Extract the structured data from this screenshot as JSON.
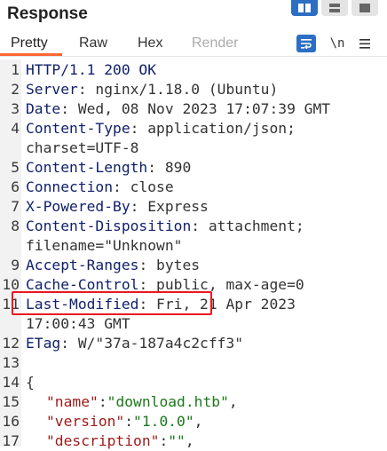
{
  "header": {
    "title": "Response"
  },
  "tabs": [
    {
      "label": "Pretty"
    },
    {
      "label": "Raw"
    },
    {
      "label": "Hex"
    },
    {
      "label": "Render"
    }
  ],
  "toolbar": {
    "wrap_icon": "wrap-lines-icon",
    "newline_label": "\\n",
    "menu_icon": "hamburger-menu-icon"
  },
  "lines": [
    {
      "n": "1",
      "key": "HTTP/1.1 200 OK",
      "val": ""
    },
    {
      "n": "2",
      "key": "Server",
      "val": ": nginx/1.18.0 (Ubuntu)"
    },
    {
      "n": "3",
      "key": "Date",
      "val": ": Wed, 08 Nov 2023 17:07:39 GMT"
    },
    {
      "n": "4",
      "key": "Content-Type",
      "val": ": application/json;"
    },
    {
      "n": "",
      "key": "",
      "val": "charset=UTF-8"
    },
    {
      "n": "5",
      "key": "Content-Length",
      "val": ": 890"
    },
    {
      "n": "6",
      "key": "Connection",
      "val": ": close"
    },
    {
      "n": "7",
      "key": "X-Powered-By",
      "val": ": Express"
    },
    {
      "n": "8",
      "key": "Content-Disposition",
      "val": ": attachment;"
    },
    {
      "n": "",
      "key": "",
      "val": "filename=\"Unknown\""
    },
    {
      "n": "9",
      "key": "Accept-Ranges",
      "val": ": bytes"
    },
    {
      "n": "10",
      "key": "Cache-Control",
      "val": ": public, max-age=0"
    },
    {
      "n": "11",
      "key": "Last-Modified",
      "val": ": Fri, 21 Apr 2023"
    },
    {
      "n": "",
      "key": "",
      "val": "17:00:43 GMT"
    },
    {
      "n": "12",
      "key": "ETag",
      "val": ": W/\"37a-187a4c2cff3\""
    },
    {
      "n": "13",
      "key": "",
      "val": ""
    },
    {
      "n": "14",
      "key": "",
      "val": "{"
    }
  ],
  "json_lines": [
    {
      "n": "15",
      "jk": "\"name\"",
      "sep": ":",
      "js": "\"download.htb\"",
      "tail": ","
    },
    {
      "n": "16",
      "jk": "\"version\"",
      "sep": ":",
      "js": "\"1.0.0\"",
      "tail": ","
    },
    {
      "n": "17",
      "jk": "\"description\"",
      "sep": ":",
      "js": "\"\"",
      "tail": ","
    }
  ]
}
